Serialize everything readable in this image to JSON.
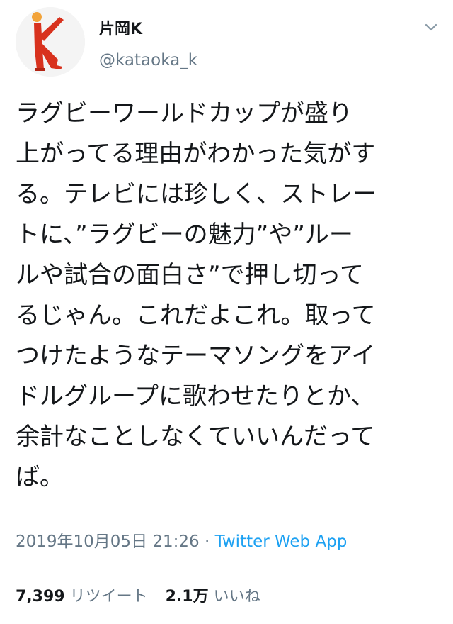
{
  "tweet": {
    "author_name": "片岡K",
    "author_handle": "@kataoka_k",
    "text_lines": [
      "ラグビーワールドカップが盛り",
      "上がってる理由がわかった気がす",
      "る。テレビには珍しく、ストレー",
      "トに、”ラグビーの魅力”や”ルー",
      "ルや試合の面白さ”で押し切って",
      "るじゃん。これだよこれ。取って",
      "つけたようなテーマソングをアイ",
      "ドルグループに歌わせたりとか、",
      "余計なことしなくていいんだって",
      "ば。"
    ],
    "timestamp": "2019年10月05日 21:26",
    "separator": " · ",
    "source_app": "Twitter Web App",
    "retweet_count": "7,399",
    "retweet_label": "リツイート",
    "like_count": "2.1万",
    "like_label": "いいね"
  },
  "icons": {
    "menu": "chevron-down-icon",
    "avatar": "avatar-image"
  },
  "colors": {
    "link": "#1da1f2",
    "muted": "#657786",
    "text": "#14171a",
    "avatar_figure": "#d8321e"
  }
}
